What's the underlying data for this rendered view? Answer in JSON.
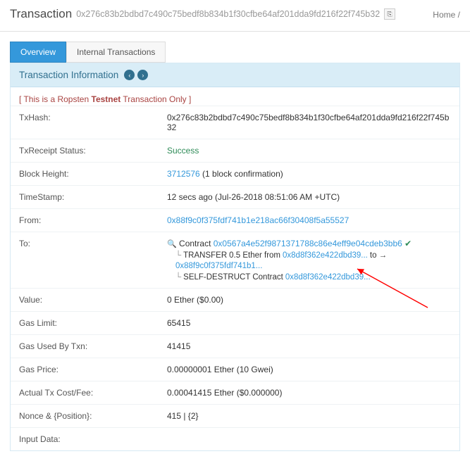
{
  "header": {
    "title": "Transaction",
    "hash": "0x276c83b2bdbd7c490c75bedf8b834b1f30cfbe64af201dda9fd216f22f745b32",
    "breadcrumb_home": "Home",
    "breadcrumb_sep": "/"
  },
  "tabs": {
    "overview": "Overview",
    "internal": "Internal Transactions"
  },
  "panel_title": "Transaction Information",
  "testnet_note_pre": "[ This is a Ropsten ",
  "testnet_note_bold": "Testnet",
  "testnet_note_post": " Transaction Only ]",
  "rows": {
    "txhash": {
      "label": "TxHash:",
      "value": "0x276c83b2bdbd7c490c75bedf8b834b1f30cfbe64af201dda9fd216f22f745b32"
    },
    "receipt": {
      "label": "TxReceipt Status:",
      "value": "Success"
    },
    "block": {
      "label": "Block Height:",
      "link": "3712576",
      "suffix": " (1 block confirmation)"
    },
    "time": {
      "label": "TimeStamp:",
      "value": "12 secs ago (Jul-26-2018 08:51:06 AM +UTC)"
    },
    "from": {
      "label": "From:",
      "link": "0x88f9c0f375fdf741b1e218ac66f30408f5a55527"
    },
    "to": {
      "label": "To:",
      "contract_word": "Contract",
      "contract_link": "0x0567a4e52f9871371788c86e4eff9e04cdeb3bb6",
      "transfer_word": "TRANSFER",
      "transfer_mid": "  0.5 Ether from ",
      "transfer_from": "0x8d8f362e422dbd39...",
      "transfer_to_word": " to → ",
      "transfer_to": "0x88f9c0f375fdf741b1...",
      "selfdestruct_word": "SELF-DESTRUCT",
      "selfdestruct_mid": " Contract ",
      "selfdestruct_link": "0x8d8f362e422dbd39..."
    },
    "value": {
      "label": "Value:",
      "value": "0 Ether ($0.00)"
    },
    "gaslimit": {
      "label": "Gas Limit:",
      "value": "65415"
    },
    "gasused": {
      "label": "Gas Used By Txn:",
      "value": "41415"
    },
    "gasprice": {
      "label": "Gas Price:",
      "value": "0.00000001 Ether (10 Gwei)"
    },
    "cost": {
      "label": "Actual Tx Cost/Fee:",
      "value": "0.00041415 Ether ($0.000000)"
    },
    "nonce": {
      "label": "Nonce & {Position}:",
      "value": "415 | {2}"
    },
    "input": {
      "label": "Input Data:",
      "value": ""
    }
  }
}
